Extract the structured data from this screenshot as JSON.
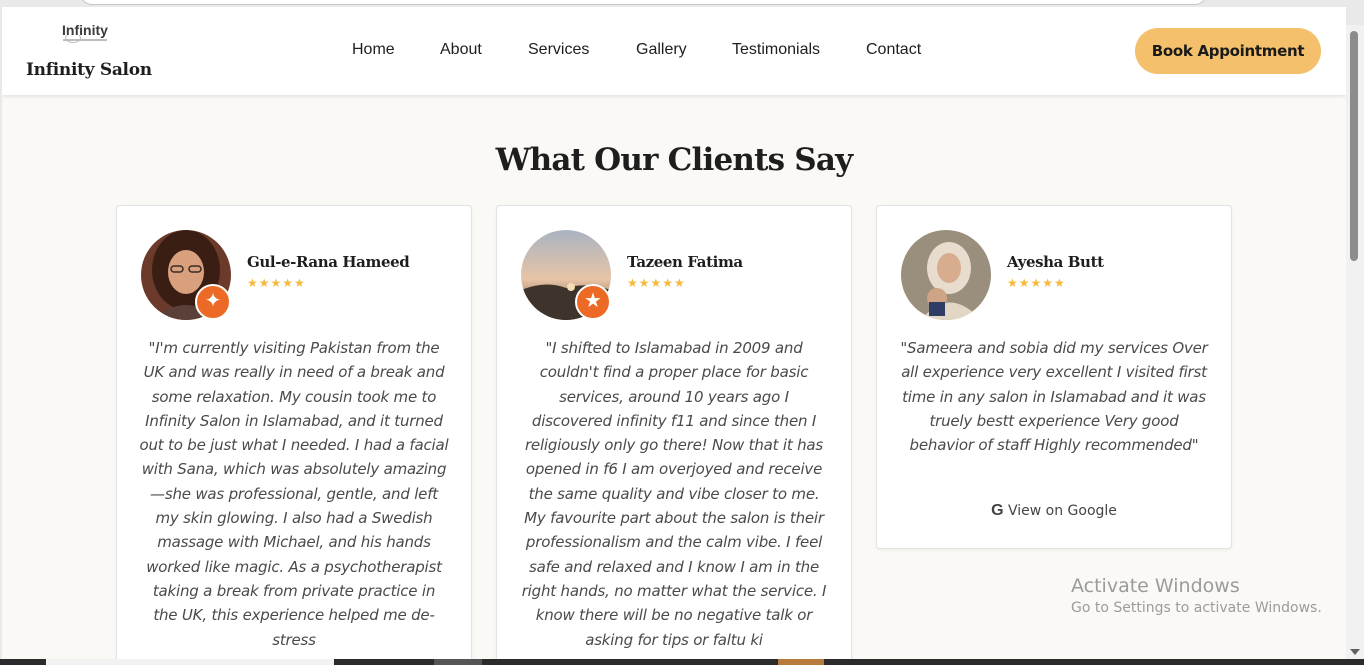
{
  "header": {
    "logo_text": "Infinity",
    "brand_name": "Infinity Salon",
    "nav": [
      "Home",
      "About",
      "Services",
      "Gallery",
      "Testimonials",
      "Contact"
    ],
    "cta_label": "Book Appointment",
    "cta_color": "#f4c06c"
  },
  "section": {
    "title": "What Our Clients Say"
  },
  "testimonials": [
    {
      "name": "Gul-e-Rana Hameed",
      "stars": "★★★★★",
      "rating": 5,
      "badge_icon": "sparkle-icon",
      "text": "\"I'm currently visiting Pakistan from the UK and was really in need of a break and some relaxation. My cousin took me to Infinity Salon in Islamabad, and it turned out to be just what I needed. I had a facial with Sana, which was absolutely amazing—she was professional, gentle, and left my skin glowing. I also had a Swedish massage with Michael, and his hands worked like magic. As a psychotherapist taking a break from private practice in the UK, this experience helped me de-stress"
    },
    {
      "name": "Tazeen Fatima",
      "stars": "★★★★★",
      "rating": 5,
      "badge_icon": "star-icon",
      "text": "\"I shifted to Islamabad in 2009 and couldn't find a proper place for basic services, around 10 years ago I discovered infinity f11 and since then I religiously only go there! Now that it has opened in f6 I am overjoyed and receive the same quality and vibe closer to me. My favourite part about the salon is their professionalism and the calm vibe. I feel safe and relaxed and I know I am in the right hands, no matter what the service. I know there will be no negative talk or asking for tips or faltu ki"
    },
    {
      "name": "Ayesha Butt",
      "stars": "★★★★★",
      "rating": 5,
      "text": "\"Sameera and sobia did my services Over all experience very excellent I visited first time in any salon in Islamabad and it was truely bestt experience Very good behavior of staff Highly recommended\"",
      "link_label": "View on Google"
    }
  ],
  "watermark": {
    "line1": "Activate Windows",
    "line2": "Go to Settings to activate Windows."
  },
  "colors": {
    "accent": "#f4c06c",
    "badge": "#ec6a26",
    "star": "#f5b93b",
    "page_bg": "#fbf9f5"
  }
}
